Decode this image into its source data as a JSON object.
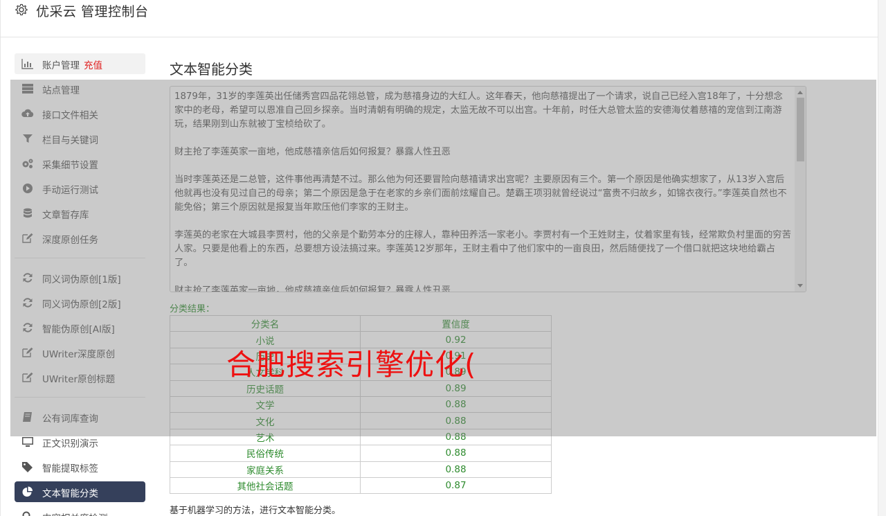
{
  "header": {
    "title": "优采云 管理控制台",
    "icon": "gear-icon"
  },
  "sidebar": {
    "items": [
      {
        "label": "账户管理",
        "badge": "充值",
        "icon": "bar-chart-icon"
      },
      {
        "label": "站点管理",
        "icon": "server-icon"
      },
      {
        "label": "接口文件相关",
        "icon": "cloud-upload-icon"
      },
      {
        "label": "栏目与关键词",
        "icon": "filter-icon"
      },
      {
        "label": "采集细节设置",
        "icon": "gears-icon"
      },
      {
        "label": "手动运行测试",
        "icon": "play-circle-icon"
      },
      {
        "label": "文章暂存库",
        "icon": "database-icon"
      },
      {
        "label": "深度原创任务",
        "icon": "edit-icon"
      },
      {
        "label": "同义词伪原创[1版]",
        "icon": "refresh-icon"
      },
      {
        "label": "同义词伪原创[2版]",
        "icon": "refresh-icon"
      },
      {
        "label": "智能伪原创[AI版]",
        "icon": "refresh-icon"
      },
      {
        "label": "UWriter深度原创",
        "icon": "edit-icon"
      },
      {
        "label": "UWriter原创标题",
        "icon": "edit-icon"
      },
      {
        "label": "公有词库查询",
        "icon": "book-icon"
      },
      {
        "label": "正文识别演示",
        "icon": "monitor-icon"
      },
      {
        "label": "智能提取标签",
        "icon": "tag-icon"
      },
      {
        "label": "文本智能分类",
        "icon": "pie-chart-icon"
      },
      {
        "label": "内容相关度检测",
        "icon": "search-icon"
      }
    ]
  },
  "main": {
    "title": "文本智能分类",
    "paragraphs": [
      "1879年，31岁的李莲英出任储秀宫四品花翎总管，成为慈禧身边的大红人。这年春天，他向慈禧提出了一个请求，说自己已经入宫18年了，十分想念家中的老母，希望可以恩准自己回乡探亲。当时清朝有明确的规定，太监无故不可以出宫。十年前，时任大总管太监的安德海仗着慈禧的宠信到江南游玩，结果刚到山东就被丁宝桢给砍了。",
      "财主抢了李莲英家一亩地，他成慈禧亲信后如何报复？暴露人性丑恶",
      "当时李莲英还是二总管，这件事他再清楚不过。那么他为何还要冒险向慈禧请求出宫呢？主要原因有三个。第一个原因是他确实想家了，从13岁入宫后他就再也没有见过自己的母亲；第二个原因是急于在老家的乡亲们面前炫耀自己。楚霸王项羽就曾经说过“富贵不归故乡，如锦衣夜行。”李莲英自然也不能免俗；第三个原因就是报复当年欺压他们李家的王财主。",
      "李莲英的老家在大城县李贾村，他的父亲是个勤劳本分的庄稼人，靠种田养活一家老小。李贾村有一个王姓财主，仗着家里有钱，经常欺负村里面的穷苦人家。只要是他看上的东西，总要想方设法搞过来。李莲英12岁那年，王财主看中了他们家中的一亩良田，然后随便找了一个借口就把这块地给霸占了。",
      "财主抢了李莲英家一亩地，他成慈禧亲信后如何报复？暴露人性丑恶"
    ],
    "result_label": "分类结果：",
    "table": {
      "headers": [
        "分类名",
        "置信度"
      ],
      "rows": [
        [
          "小说",
          "0.92"
        ],
        [
          "历史",
          "0.91"
        ],
        [
          "人文学科",
          "0.89"
        ],
        [
          "历史话题",
          "0.89"
        ],
        [
          "文学",
          "0.88"
        ],
        [
          "文化",
          "0.88"
        ],
        [
          "艺术",
          "0.88"
        ],
        [
          "民俗传统",
          "0.88"
        ],
        [
          "家庭关系",
          "0.88"
        ],
        [
          "其他社会话题",
          "0.87"
        ]
      ]
    },
    "note": "基于机器学习的方法，进行文本智能分类。"
  },
  "watermark": "合肥搜索引擎优化(",
  "colors": {
    "active_nav": "#35405b",
    "result_green": "#2e8b2e",
    "watermark_red": "#ee1111",
    "recharge_red": "#e02020"
  }
}
